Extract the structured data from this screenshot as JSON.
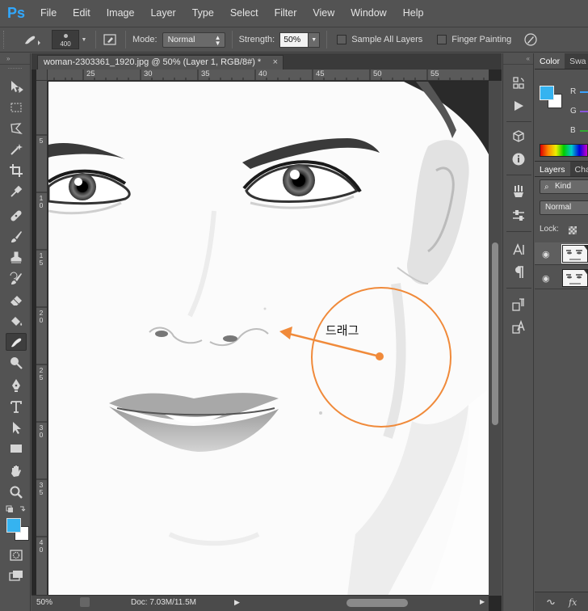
{
  "app": {
    "logo": "Ps"
  },
  "menu": [
    "File",
    "Edit",
    "Image",
    "Layer",
    "Type",
    "Select",
    "Filter",
    "View",
    "Window",
    "Help"
  ],
  "options": {
    "brush_size": "400",
    "mode_label": "Mode:",
    "mode_value": "Normal",
    "strength_label": "Strength:",
    "strength_value": "50%",
    "sample_all_layers": "Sample All Layers",
    "finger_painting": "Finger Painting"
  },
  "document": {
    "tab_title": "woman-2303361_1920.jpg @ 50% (Layer 1, RGB/8#) *",
    "close_glyph": "×",
    "ruler_h": [
      "25",
      "30",
      "35",
      "40",
      "45",
      "50",
      "55"
    ],
    "ruler_v": [
      "5",
      "1 0",
      "1 5",
      "2 0",
      "2 5",
      "3 0",
      "3 5",
      "4 0"
    ]
  },
  "status": {
    "zoom": "50%",
    "doc_size": "Doc: 7.03M/11.5M"
  },
  "annotation": {
    "label": "드래그",
    "accent_color": "#f08a3a"
  },
  "color_panel": {
    "tabs": [
      "Color",
      "Swa"
    ],
    "channels": [
      "R",
      "G",
      "B"
    ],
    "foreground": "#35b3f0",
    "background": "#ffffff"
  },
  "layers_panel": {
    "tabs": [
      "Layers",
      "Cha"
    ],
    "kind_label": "Kind",
    "blend_mode": "Normal",
    "lock_label": "Lock:"
  },
  "panel_headers": {
    "collapse_left": "»",
    "collapse_right": "«"
  }
}
